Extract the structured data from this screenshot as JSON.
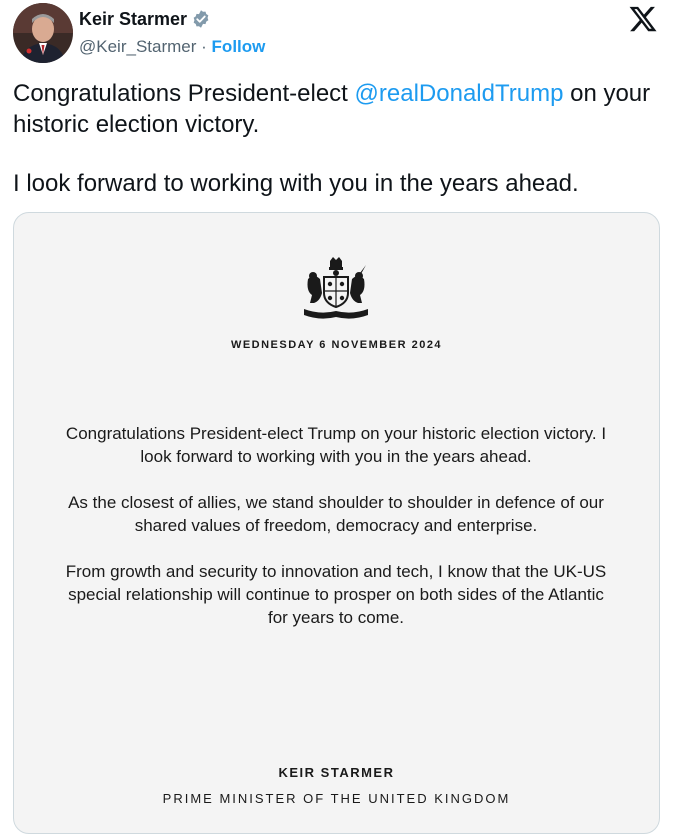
{
  "author": {
    "name": "Keir Starmer",
    "handle": "@Keir_Starmer",
    "separator": "·",
    "follow_label": "Follow",
    "avatar_icon": "profile-photo"
  },
  "tweet": {
    "line1_before": "Congratulations President-elect ",
    "mention": "@realDonaldTrump",
    "line1_after": " on your historic election victory.",
    "paragraph2": "I look forward to working with you in the years ahead."
  },
  "letter": {
    "date": "WEDNESDAY 6 NOVEMBER 2024",
    "paragraphs": [
      "Congratulations President-elect Trump on your historic election victory. I look forward to working with you in the years ahead.",
      "As the closest of allies, we stand shoulder to shoulder in defence of our shared values of freedom, democracy and enterprise.",
      "From growth and security to innovation and tech, I know that the UK-US special relationship will continue to prosper on both sides of the Atlantic for years to come."
    ],
    "signature": "KEIR STARMER",
    "signature_title": "PRIME MINISTER OF THE UNITED KINGDOM"
  },
  "colors": {
    "link": "#1d9bf0",
    "text": "#0f1419",
    "secondary": "#536471",
    "verified_badge": "#829aab"
  }
}
